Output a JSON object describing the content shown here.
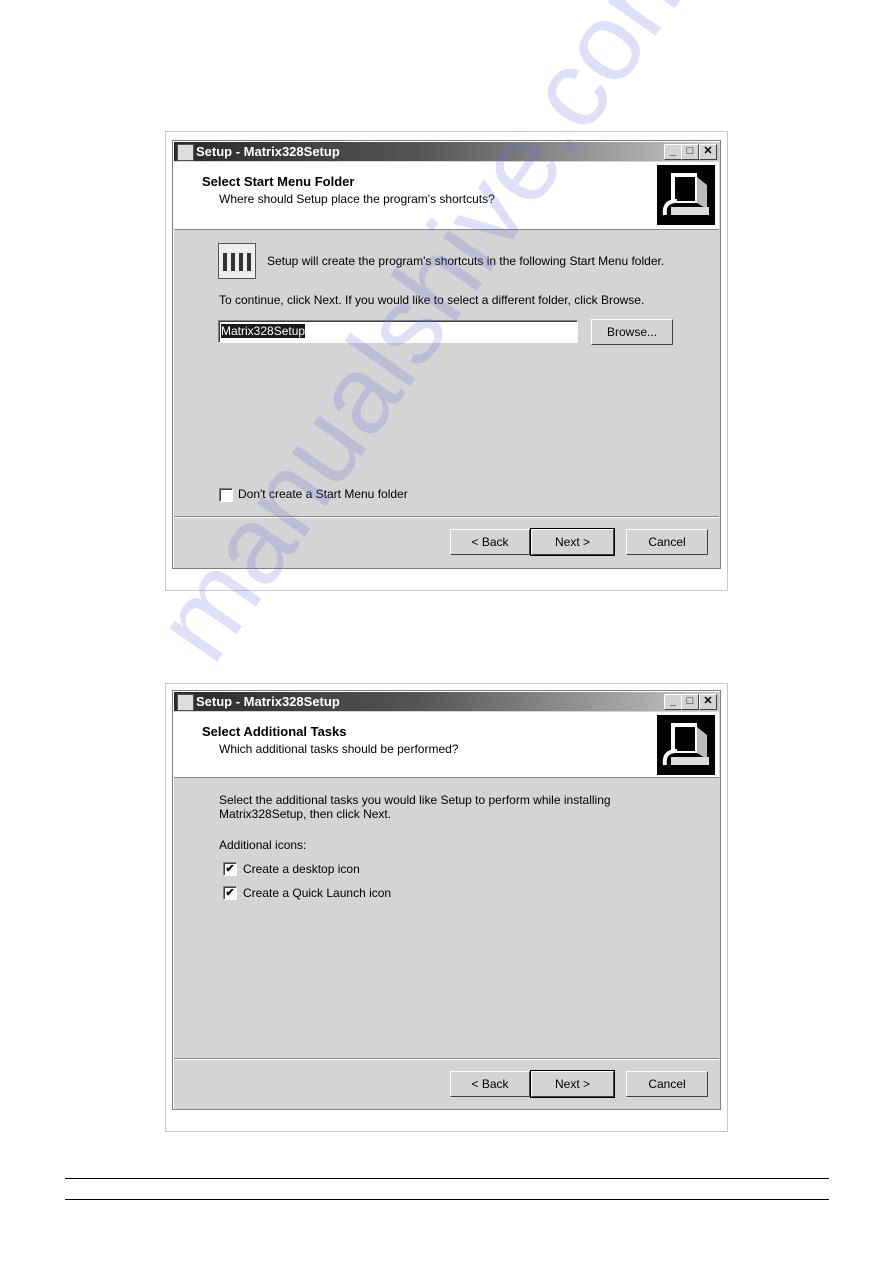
{
  "dialog1": {
    "title": "Setup - Matrix328Setup",
    "heading": "Select Start Menu Folder",
    "subheading": "Where should Setup place the program's shortcuts?",
    "info": "Setup will create the program's shortcuts in the following Start Menu folder.",
    "instruction": "To continue, click Next. If you would like to select a different folder, click Browse.",
    "folder_value": "Matrix328Setup",
    "browse_label": "Browse...",
    "checkbox_label": "Don't create a Start Menu folder",
    "checkbox_checked": false,
    "back_label": "< Back",
    "next_label": "Next >",
    "cancel_label": "Cancel"
  },
  "dialog2": {
    "title": "Setup - Matrix328Setup",
    "heading": "Select Additional Tasks",
    "subheading": "Which additional tasks should be performed?",
    "intro_line1": "Select the additional tasks you would like Setup to perform while installing",
    "intro_line2": "Matrix328Setup, then click Next.",
    "group_label": "Additional icons:",
    "tasks": [
      {
        "label": "Create a desktop icon",
        "checked": true
      },
      {
        "label": "Create a Quick Launch icon",
        "checked": true
      }
    ],
    "back_label": "< Back",
    "next_label": "Next >",
    "cancel_label": "Cancel"
  },
  "watermark": "manualshive.com",
  "icons": {
    "check": "✔",
    "minimize": "_",
    "maximize": "□",
    "close": "✕"
  }
}
